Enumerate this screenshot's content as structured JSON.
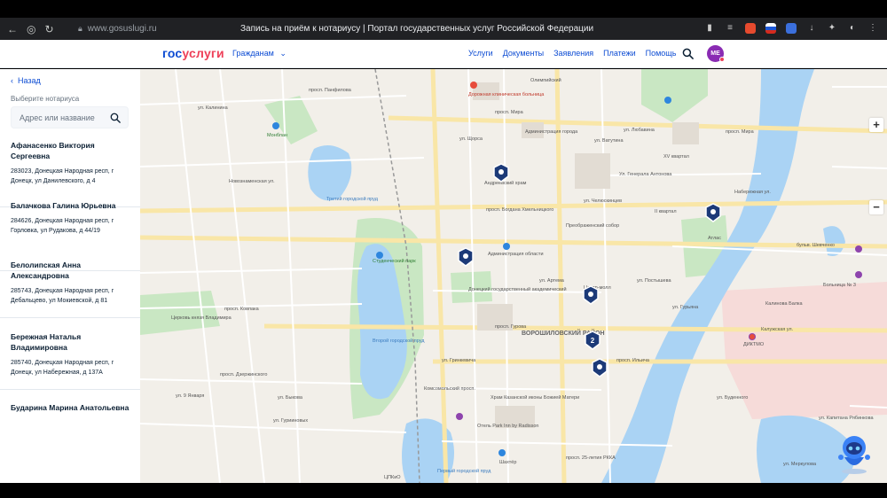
{
  "browser": {
    "url": "www.gosuslugi.ru",
    "title": "Запись на приём к нотариусу | Портал государственных услуг Российской Федерации"
  },
  "header": {
    "logo_part1": "гос",
    "logo_part2": "услуги",
    "audience": "Гражданам",
    "nav": [
      "Услуги",
      "Документы",
      "Заявления",
      "Платежи",
      "Помощь"
    ],
    "avatar_initials": "МЕ"
  },
  "sidebar": {
    "back_label": "Назад",
    "choose_label": "Выберите нотариуса",
    "search_placeholder": "Адрес или название",
    "notaries": [
      {
        "name": "Афанасенко Виктория Сергеевна",
        "address": "283023, Донецкая Народная респ, г Донецк, ул Данилевского, д 4"
      },
      {
        "name": "Балачкова Галина Юрьевна",
        "address": "284626, Донецкая Народная респ, г Горловка, ул Рудакова, д 44/19"
      },
      {
        "name": "Белолипская Анна Александровна",
        "address": "285743, Донецкая Народная респ, г Дебальцево, ул Мокиевской, д 81"
      },
      {
        "name": "Бережная Наталья Владимировна",
        "address": "285740, Донецкая Народная респ, г Донецк, ул Набережная, д 137А"
      },
      {
        "name": "Бударина Марина Анатольевна",
        "address": ""
      }
    ]
  },
  "map": {
    "cluster_count": "2",
    "zoom_in": "+",
    "zoom_out": "−",
    "labels": {
      "l1": "ул. Калинина",
      "l2": "просп. Панфилова",
      "l3": "Дорожная клиническая больница",
      "l4": "Олимпийский",
      "l5": "просп. Мира",
      "l6": "ул. Любавина",
      "l7": "Администрация города",
      "l8": "ул. Ватутина",
      "l9": "Андреевский храм",
      "l10": "просп. Богдана Хмельницкого",
      "l11": "Третий городской пруд",
      "l12": "Администрация области",
      "l13": "Преображенский собор",
      "l14": "бульв. Шевченко",
      "l15": "Атлас",
      "l16": "Студенческий парк",
      "l17": "Донецкий государственный академический",
      "l18": "Центр-молл",
      "l19": "просп. Гурова",
      "l20": "ВОРОШИЛОВСКИЙ РАЙОН",
      "l21": "Второй городской пруд",
      "l22": "просп. Ильича",
      "l23": "Комсомольский просп.",
      "l24": "Храм Казанской иконы Божией Матери",
      "l25": "Отель Park Inn by Radisson",
      "l26": "Шахтёр",
      "l27": "Первый городской пруд",
      "l28": "ЦПКиО",
      "l29": "просп. Ковпака",
      "l30": "Церковь князя Владимира",
      "l31": "просп. Дзержинского",
      "l32": "ул. Артема",
      "l33": "Калинова Балка",
      "l34": "Больница № 3",
      "l35": "ДИКТМО",
      "l36": "ул. Капитана Рябинкова",
      "l37": "ул. Меркулова",
      "l38": "ул. Гурьяна",
      "l39": "просп. 25-летия РККА",
      "l40": "ул. Буденного",
      "l41": "Новознаменская ул.",
      "l42": "ул. Гринкевича",
      "l43": "ул. Челюскинцев",
      "l44": "Набережная ул.",
      "l45": "ул. Щорса",
      "l46": "ул. Постышева",
      "l47": "Ул. Генерала Антонова",
      "l48": "Монблан",
      "l49": "ул. Быкова",
      "l50": "ул. Гурииновых",
      "l51": "ул. 9 Января",
      "l52": "XV квартал",
      "l53": "II квартал",
      "l54": "просп. Мира",
      "l55": "Калужская ул."
    }
  },
  "colors": {
    "brand_blue": "#0d4cd3",
    "brand_red": "#ee3f58",
    "water": "#aad3f4",
    "park": "#c5e8c5",
    "pin": "#1c3a78"
  }
}
